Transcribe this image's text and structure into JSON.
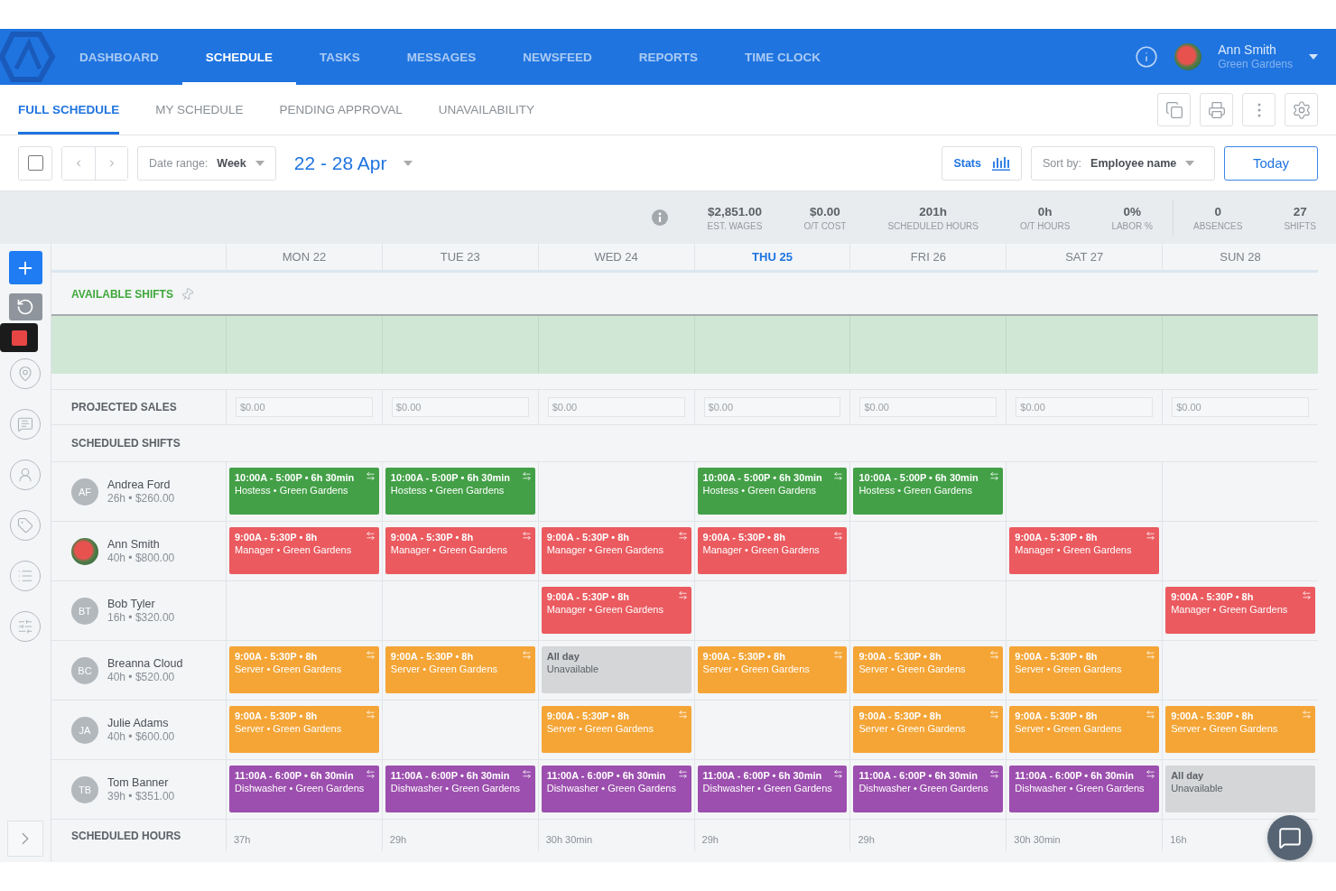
{
  "nav": {
    "items": [
      {
        "label": "DASHBOARD",
        "selected": false
      },
      {
        "label": "SCHEDULE",
        "selected": true
      },
      {
        "label": "TASKS",
        "selected": false
      },
      {
        "label": "MESSAGES",
        "selected": false
      },
      {
        "label": "NEWSFEED",
        "selected": false
      },
      {
        "label": "REPORTS",
        "selected": false
      },
      {
        "label": "TIME CLOCK",
        "selected": false
      }
    ],
    "user": {
      "name": "Ann Smith",
      "org": "Green Gardens"
    }
  },
  "subtabs": [
    {
      "label": "FULL SCHEDULE",
      "selected": true
    },
    {
      "label": "MY SCHEDULE",
      "selected": false
    },
    {
      "label": "PENDING APPROVAL",
      "selected": false
    },
    {
      "label": "UNAVAILABILITY",
      "selected": false
    }
  ],
  "toolbar": {
    "select_all": {
      "checked": false
    },
    "date_range_label": "Date range:",
    "date_range_value": "Week",
    "period": "22 - 28 Apr",
    "stats_button": "Stats",
    "sort_label": "Sort by:",
    "sort_value": "Employee name",
    "today_button": "Today"
  },
  "stats": [
    {
      "value": "$2,851.00",
      "label": "EST. WAGES"
    },
    {
      "value": "$0.00",
      "label": "O/T COST"
    },
    {
      "value": "201h",
      "label": "SCHEDULED HOURS"
    },
    {
      "value": "0h",
      "label": "O/T HOURS"
    },
    {
      "value": "0%",
      "label": "LABOR %"
    },
    {
      "value": "0",
      "label": "ABSENCES"
    },
    {
      "value": "27",
      "label": "SHIFTS"
    }
  ],
  "days": [
    {
      "label": "MON 22",
      "selected": false
    },
    {
      "label": "TUE 23",
      "selected": false
    },
    {
      "label": "WED 24",
      "selected": false
    },
    {
      "label": "THU 25",
      "selected": true
    },
    {
      "label": "FRI 26",
      "selected": false
    },
    {
      "label": "SAT 27",
      "selected": false
    },
    {
      "label": "SUN 28",
      "selected": false
    }
  ],
  "available_shifts": {
    "title": "AVAILABLE SHIFTS"
  },
  "projected_sales": {
    "label": "PROJECTED SALES",
    "values": [
      "$0.00",
      "$0.00",
      "$0.00",
      "$0.00",
      "$0.00",
      "$0.00",
      "$0.00"
    ]
  },
  "scheduled_shifts": {
    "label": "SCHEDULED SHIFTS",
    "employees": [
      {
        "name": "Andrea Ford",
        "summary": "26h • $260.00",
        "avatar": {
          "kind": "initials",
          "text": "AF"
        },
        "cells": [
          {
            "kind": "shift",
            "color": "#43a047",
            "time": "10:00A - 5:00P • 6h 30min",
            "role": "Hostess • Green Gardens"
          },
          {
            "kind": "shift",
            "color": "#43a047",
            "time": "10:00A - 5:00P • 6h 30min",
            "role": "Hostess • Green Gardens"
          },
          null,
          {
            "kind": "shift",
            "color": "#43a047",
            "time": "10:00A - 5:00P • 6h 30min",
            "role": "Hostess • Green Gardens"
          },
          {
            "kind": "shift",
            "color": "#43a047",
            "time": "10:00A - 5:00P • 6h 30min",
            "role": "Hostess • Green Gardens"
          },
          null,
          null
        ]
      },
      {
        "name": "Ann Smith",
        "summary": "40h • $800.00",
        "cells": [
          {
            "kind": "shift",
            "color": "#ea5a5f",
            "time": "9:00A - 5:30P • 8h",
            "role": "Manager • Green Gardens"
          },
          {
            "kind": "shift",
            "color": "#ea5a5f",
            "time": "9:00A - 5:30P • 8h",
            "role": "Manager • Green Gardens"
          },
          {
            "kind": "shift",
            "color": "#ea5a5f",
            "time": "9:00A - 5:30P • 8h",
            "role": "Manager • Green Gardens"
          },
          {
            "kind": "shift",
            "color": "#ea5a5f",
            "time": "9:00A - 5:30P • 8h",
            "role": "Manager • Green Gardens"
          },
          null,
          {
            "kind": "shift",
            "color": "#ea5a5f",
            "time": "9:00A - 5:30P • 8h",
            "role": "Manager • Green Gardens"
          },
          null
        ]
      },
      {
        "name": "Bob Tyler",
        "summary": "16h • $320.00",
        "avatar": {
          "kind": "initials",
          "text": "BT"
        },
        "cells": [
          null,
          null,
          {
            "kind": "shift",
            "color": "#ea5a5f",
            "time": "9:00A - 5:30P • 8h",
            "role": "Manager • Green Gardens"
          },
          null,
          null,
          null,
          {
            "kind": "shift",
            "color": "#ea5a5f",
            "time": "9:00A - 5:30P • 8h",
            "role": "Manager • Green Gardens"
          }
        ]
      },
      {
        "name": "Breanna Cloud",
        "summary": "40h • $520.00",
        "avatar": {
          "kind": "initials",
          "text": "BC"
        },
        "cells": [
          {
            "kind": "shift",
            "color": "#f4a536",
            "time": "9:00A - 5:30P • 8h",
            "role": "Server • Green Gardens"
          },
          {
            "kind": "shift",
            "color": "#f4a536",
            "time": "9:00A - 5:30P • 8h",
            "role": "Server • Green Gardens"
          },
          {
            "kind": "unavailable",
            "time": "All day",
            "role": "Unavailable"
          },
          {
            "kind": "shift",
            "color": "#f4a536",
            "time": "9:00A - 5:30P • 8h",
            "role": "Server • Green Gardens"
          },
          {
            "kind": "shift",
            "color": "#f4a536",
            "time": "9:00A - 5:30P • 8h",
            "role": "Server • Green Gardens"
          },
          {
            "kind": "shift",
            "color": "#f4a536",
            "time": "9:00A - 5:30P • 8h",
            "role": "Server • Green Gardens"
          },
          null
        ]
      },
      {
        "name": "Julie Adams",
        "summary": "40h • $600.00",
        "avatar": {
          "kind": "initials",
          "text": "JA"
        },
        "cells": [
          {
            "kind": "shift",
            "color": "#f4a536",
            "time": "9:00A - 5:30P • 8h",
            "role": "Server • Green Gardens"
          },
          null,
          {
            "kind": "shift",
            "color": "#f4a536",
            "time": "9:00A - 5:30P • 8h",
            "role": "Server • Green Gardens"
          },
          null,
          {
            "kind": "shift",
            "color": "#f4a536",
            "time": "9:00A - 5:30P • 8h",
            "role": "Server • Green Gardens"
          },
          {
            "kind": "shift",
            "color": "#f4a536",
            "time": "9:00A - 5:30P • 8h",
            "role": "Server • Green Gardens"
          },
          {
            "kind": "shift",
            "color": "#f4a536",
            "time": "9:00A - 5:30P • 8h",
            "role": "Server • Green Gardens"
          }
        ]
      },
      {
        "name": "Tom Banner",
        "summary": "39h • $351.00",
        "avatar": {
          "kind": "initials",
          "text": "TB"
        },
        "cells": [
          {
            "kind": "shift",
            "color": "#9c4fae",
            "time": "11:00A - 6:00P • 6h 30min",
            "role": "Dishwasher • Green Gardens"
          },
          {
            "kind": "shift",
            "color": "#9c4fae",
            "time": "11:00A - 6:00P • 6h 30min",
            "role": "Dishwasher • Green Gardens"
          },
          {
            "kind": "shift",
            "color": "#9c4fae",
            "time": "11:00A - 6:00P • 6h 30min",
            "role": "Dishwasher • Green Gardens"
          },
          {
            "kind": "shift",
            "color": "#9c4fae",
            "time": "11:00A - 6:00P • 6h 30min",
            "role": "Dishwasher • Green Gardens"
          },
          {
            "kind": "shift",
            "color": "#9c4fae",
            "time": "11:00A - 6:00P • 6h 30min",
            "role": "Dishwasher • Green Gardens"
          },
          {
            "kind": "shift",
            "color": "#9c4fae",
            "time": "11:00A - 6:00P • 6h 30min",
            "role": "Dishwasher • Green Gardens"
          },
          {
            "kind": "unavailable",
            "time": "All day",
            "role": "Unavailable"
          }
        ]
      }
    ]
  },
  "scheduled_hours": {
    "label": "SCHEDULED HOURS",
    "values": [
      "37h",
      "29h",
      "30h 30min",
      "29h",
      "29h",
      "30h 30min",
      "16h"
    ]
  }
}
